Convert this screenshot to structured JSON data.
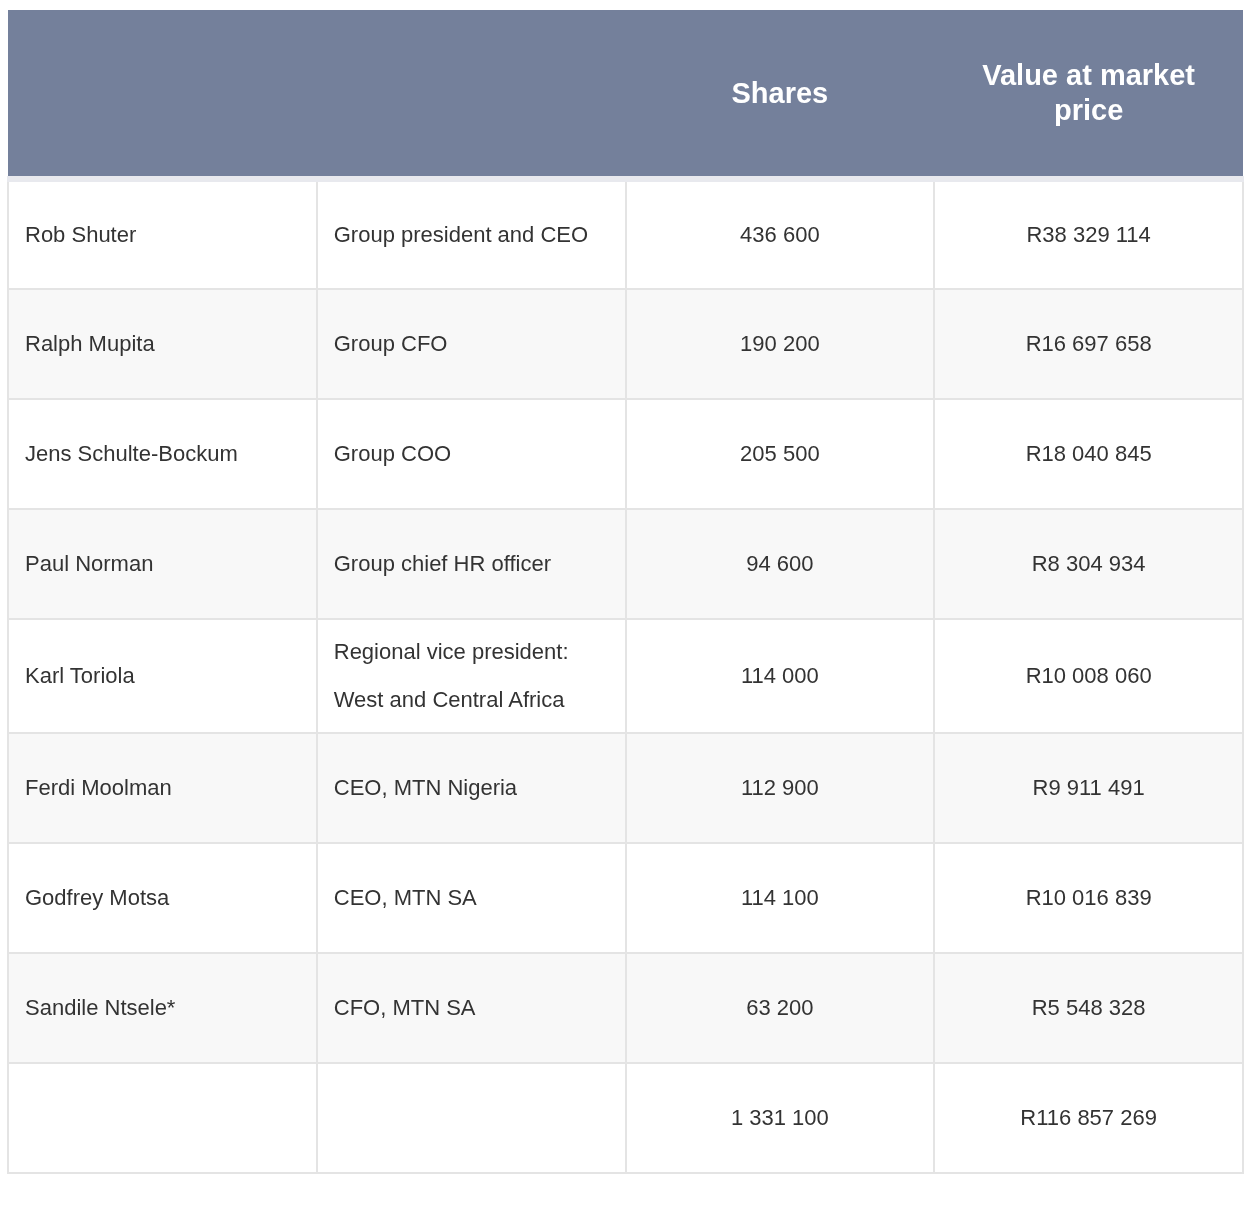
{
  "table": {
    "columns": [
      "Shares",
      "Value at market price"
    ],
    "rows": [
      {
        "name": "Rob Shuter",
        "role": "Group president and CEO",
        "shares": "436 600",
        "value": "R38 329 114"
      },
      {
        "name": "Ralph Mupita",
        "role": "Group CFO",
        "shares": "190 200",
        "value": "R16 697 658"
      },
      {
        "name": "Jens Schulte-Bockum",
        "role": "Group COO",
        "shares": "205 500",
        "value": "R18 040 845"
      },
      {
        "name": "Paul Norman",
        "role": "Group chief HR officer",
        "shares": "94 600",
        "value": "R8 304 934"
      },
      {
        "name": "Karl Toriola",
        "role": "Regional vice president: West and Central Africa",
        "shares": "114 000",
        "value": "R10 008 060"
      },
      {
        "name": "Ferdi Moolman",
        "role": "CEO, MTN Nigeria",
        "shares": "112 900",
        "value": "R9 911 491"
      },
      {
        "name": "Godfrey Motsa",
        "role": "CEO, MTN SA",
        "shares": "114 100",
        "value": "R10 016 839"
      },
      {
        "name": "Sandile Ntsele*",
        "role": "CFO, MTN SA",
        "shares": "63 200",
        "value": "R5 548 328"
      },
      {
        "shares": "1 331 100",
        "value": "R116 857 269"
      }
    ]
  }
}
